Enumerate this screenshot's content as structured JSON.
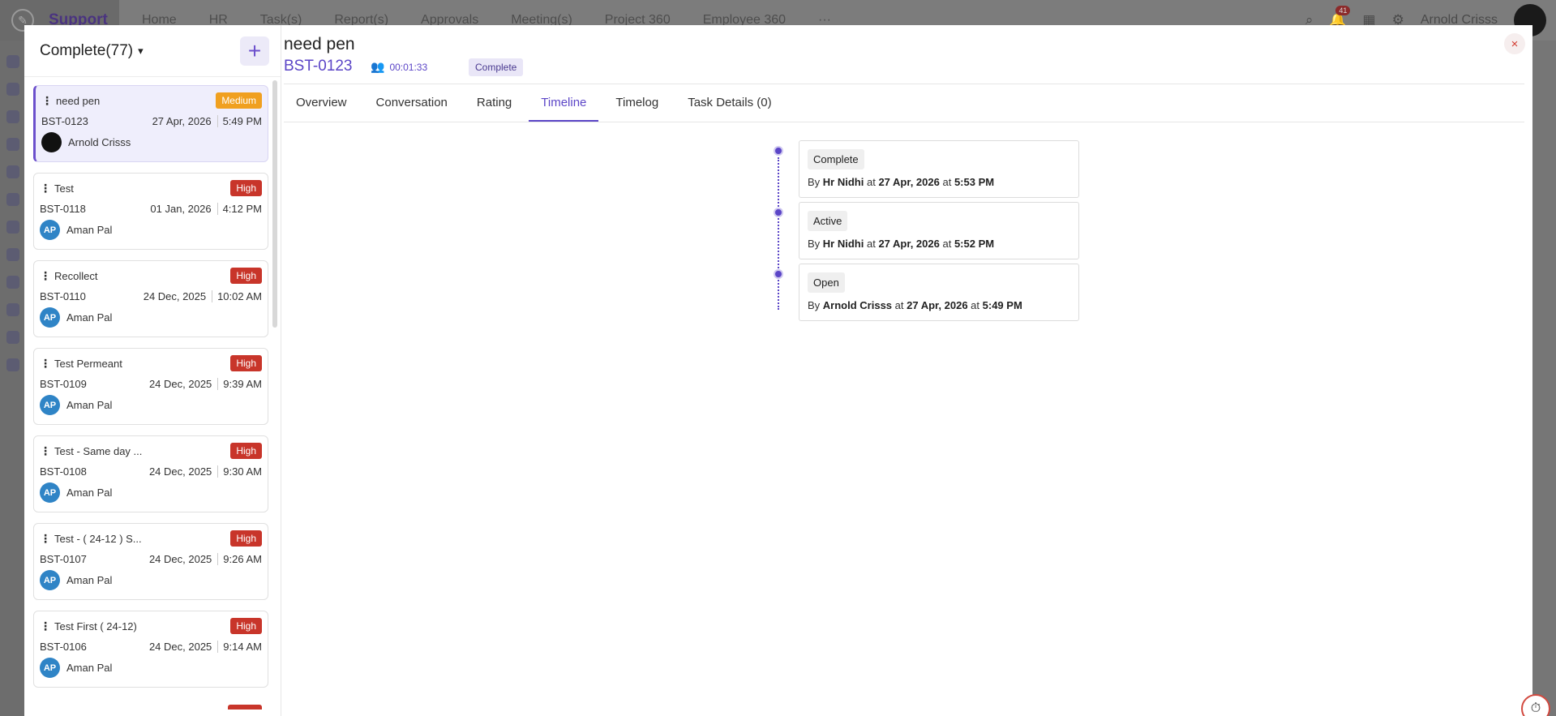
{
  "background": {
    "logo_text": "Support",
    "nav": [
      "Home",
      "HR",
      "Task(s)",
      "Report(s)",
      "Approvals",
      "Meeting(s)",
      "Project 360",
      "Employee 360"
    ],
    "more": "···",
    "notification_count": "41",
    "user_name": "Arnold Crisss"
  },
  "left_panel": {
    "title": "Complete(77)",
    "add_label": "+",
    "tasks": [
      {
        "name": "need pen",
        "priority": "Medium",
        "code": "BST-0123",
        "date": "27 Apr, 2026",
        "time": "5:49 PM",
        "assignee": "Arnold Crisss",
        "initials": ""
      },
      {
        "name": "Test",
        "priority": "High",
        "code": "BST-0118",
        "date": "01 Jan, 2026",
        "time": "4:12 PM",
        "assignee": "Aman Pal",
        "initials": "AP"
      },
      {
        "name": "Recollect",
        "priority": "High",
        "code": "BST-0110",
        "date": "24 Dec, 2025",
        "time": "10:02 AM",
        "assignee": "Aman Pal",
        "initials": "AP"
      },
      {
        "name": "Test Permeant",
        "priority": "High",
        "code": "BST-0109",
        "date": "24 Dec, 2025",
        "time": "9:39 AM",
        "assignee": "Aman Pal",
        "initials": "AP"
      },
      {
        "name": "Test - Same day ...",
        "priority": "High",
        "code": "BST-0108",
        "date": "24 Dec, 2025",
        "time": "9:30 AM",
        "assignee": "Aman Pal",
        "initials": "AP"
      },
      {
        "name": "Test - ( 24-12 ) S...",
        "priority": "High",
        "code": "BST-0107",
        "date": "24 Dec, 2025",
        "time": "9:26 AM",
        "assignee": "Aman Pal",
        "initials": "AP"
      },
      {
        "name": "Test First ( 24-12)",
        "priority": "High",
        "code": "BST-0106",
        "date": "24 Dec, 2025",
        "time": "9:14 AM",
        "assignee": "Aman Pal",
        "initials": "AP"
      }
    ]
  },
  "detail": {
    "title": "need pen",
    "code": "BST-0123",
    "timer": "00:01:33",
    "status": "Complete",
    "close_label": "×",
    "tabs": [
      "Overview",
      "Conversation",
      "Rating",
      "Timeline",
      "Timelog",
      "Task Details (0)"
    ],
    "active_tab": "Timeline",
    "timeline": [
      {
        "status": "Complete",
        "by_prefix": "By",
        "by": "Hr Nidhi",
        "at1": "at",
        "date": "27 Apr, 2026",
        "at2": "at",
        "time": "5:53 PM"
      },
      {
        "status": "Active",
        "by_prefix": "By",
        "by": "Hr Nidhi",
        "at1": "at",
        "date": "27 Apr, 2026",
        "at2": "at",
        "time": "5:52 PM"
      },
      {
        "status": "Open",
        "by_prefix": "By",
        "by": "Arnold Crisss",
        "at1": "at",
        "date": "27 Apr, 2026",
        "at2": "at",
        "time": "5:49 PM"
      }
    ]
  },
  "colors": {
    "accent": "#5b45c7",
    "high": "#c8352a",
    "medium": "#f0a020"
  }
}
